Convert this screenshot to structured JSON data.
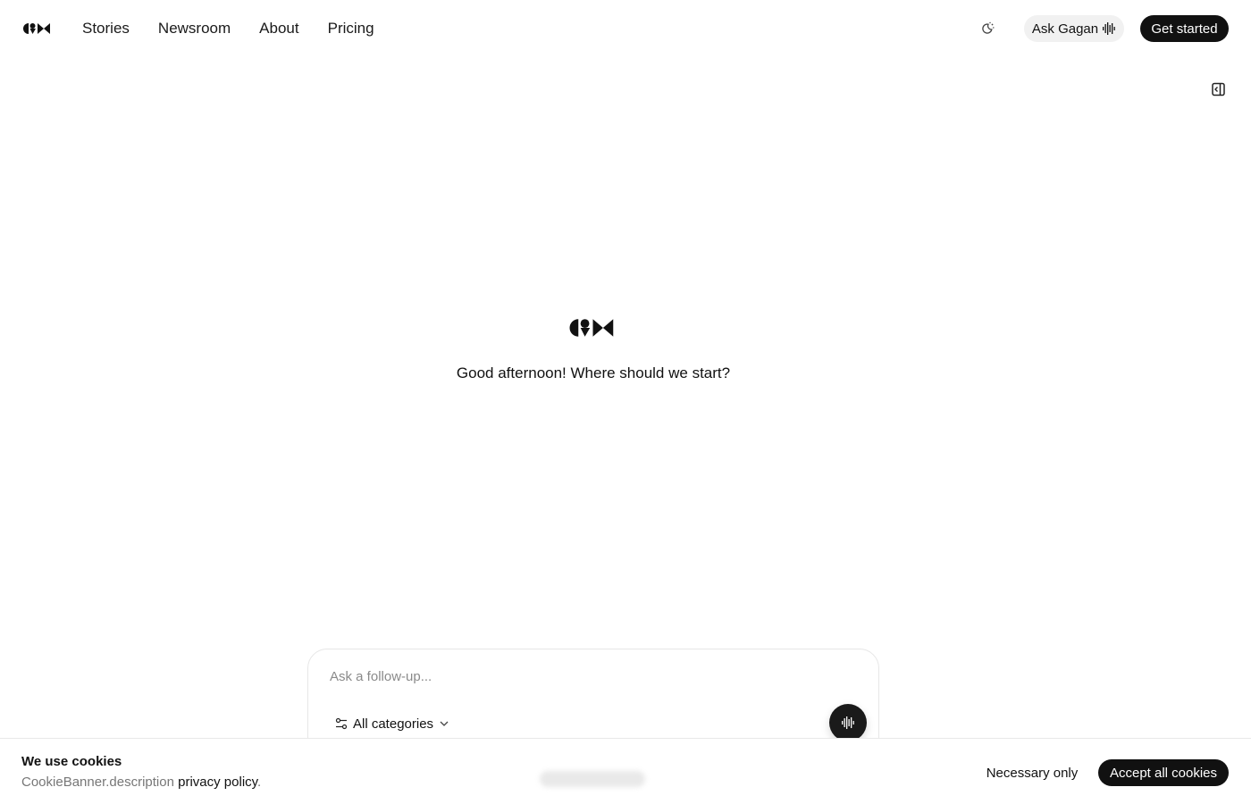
{
  "nav": {
    "logo_icon": "brand-logo",
    "items": [
      {
        "label": "Stories"
      },
      {
        "label": "Newsroom"
      },
      {
        "label": "About"
      },
      {
        "label": "Pricing"
      }
    ],
    "theme_icon": "theme-toggle-icon",
    "ask_label": "Ask Gagan",
    "ask_icon": "voice-wave-icon",
    "cta_label": "Get started"
  },
  "sidebar_toggle_icon": "sidebar-panel-icon",
  "main": {
    "greeting": "Good afternoon! Where should we start?"
  },
  "composer": {
    "placeholder": "Ask a follow-up...",
    "categories_label": "All categories",
    "categories_icon": "filter-sliders-icon",
    "dropdown_icon": "chevron-down-icon",
    "voice_icon": "voice-wave-icon"
  },
  "cookie_banner": {
    "title": "We use cookies",
    "description": "CookieBanner.description",
    "link_label": "privacy policy",
    "link_suffix": ".",
    "necessary_label": "Necessary only",
    "accept_label": "Accept all cookies"
  },
  "colors": {
    "primary": "#111111",
    "muted_text": "#777777",
    "pill_bg": "#f1f1f1"
  }
}
